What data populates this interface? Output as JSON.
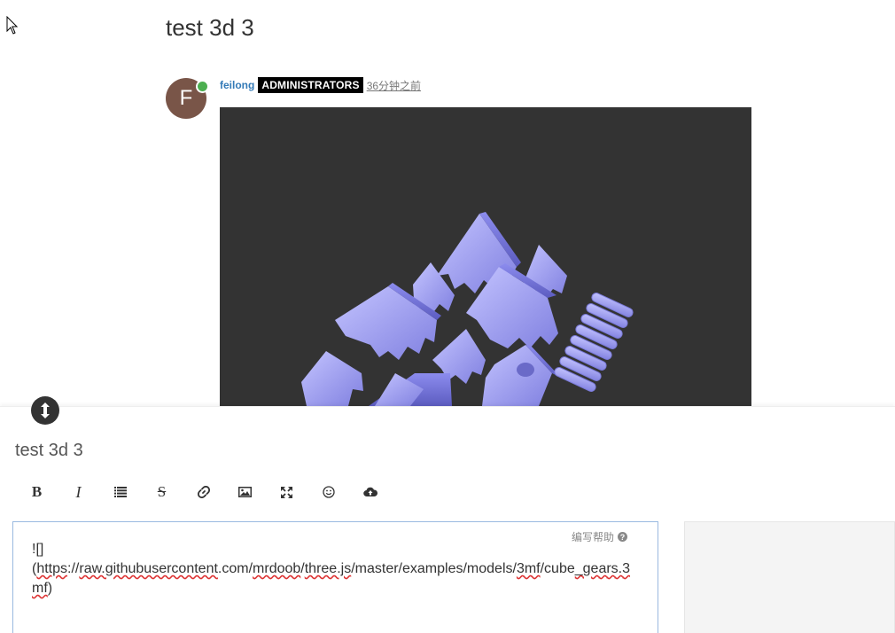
{
  "topic": {
    "title": "test 3d 3"
  },
  "post": {
    "avatar_letter": "F",
    "username": "feilong",
    "group_badge": "ADMINISTRATORS",
    "timestamp": "36分钟之前"
  },
  "composer": {
    "title": "test 3d 3",
    "help_label": "编写帮助",
    "toolbar": [
      "bold-icon",
      "italic-icon",
      "list-icon",
      "strikethrough-icon",
      "link-icon",
      "image-icon",
      "fullscreen-icon",
      "emoji-icon",
      "upload-icon"
    ],
    "body": {
      "line1": "![]",
      "line2a": "(",
      "line2b": "https",
      "line2c": "://",
      "line2d": "raw.githubusercontent",
      "line2e": ".com/",
      "line2f": "mrdoob",
      "line2g": "/",
      "line2h": "three.js",
      "line2i": "/master/examples/models/",
      "line2j": "3mf",
      "line2k": "/cube",
      "line2l": "_gears.3",
      "line3a": "mf",
      "line3b": ")"
    }
  },
  "colors": {
    "avatar_bg": "#795548",
    "online": "#4caf50",
    "viewer_bg": "#333333",
    "model": "#a3a3f5"
  }
}
